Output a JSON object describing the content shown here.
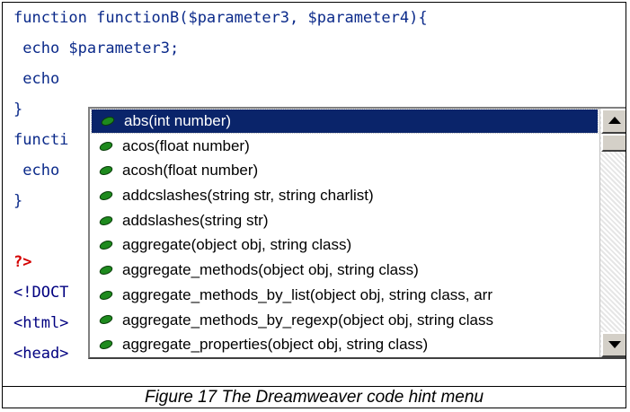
{
  "code": {
    "lines": [
      "function functionB($parameter3, $parameter4){",
      " echo $parameter3;",
      " echo",
      "}",
      "functi",
      " echo",
      "}",
      "",
      "?>",
      "<!DOCT",
      "<html>",
      "<head>"
    ]
  },
  "hint_menu": {
    "items": [
      "abs(int number)",
      "acos(float number)",
      "acosh(float number)",
      "addcslashes(string str, string charlist)",
      "addslashes(string str)",
      "aggregate(object obj, string class)",
      "aggregate_methods(object obj, string class)",
      "aggregate_methods_by_list(object obj, string class, arr",
      "aggregate_methods_by_regexp(object obj, string class",
      "aggregate_properties(object obj, string class)"
    ],
    "selected_index": 0,
    "item_icon": "php-function-leaf-icon"
  },
  "caption": "Figure 17 The Dreamweaver code hint menu",
  "colors": {
    "selection": "#0a246a",
    "keyword": "#0b2a8a",
    "php_close": "#d40000",
    "leaf": "#1e8a1e"
  }
}
